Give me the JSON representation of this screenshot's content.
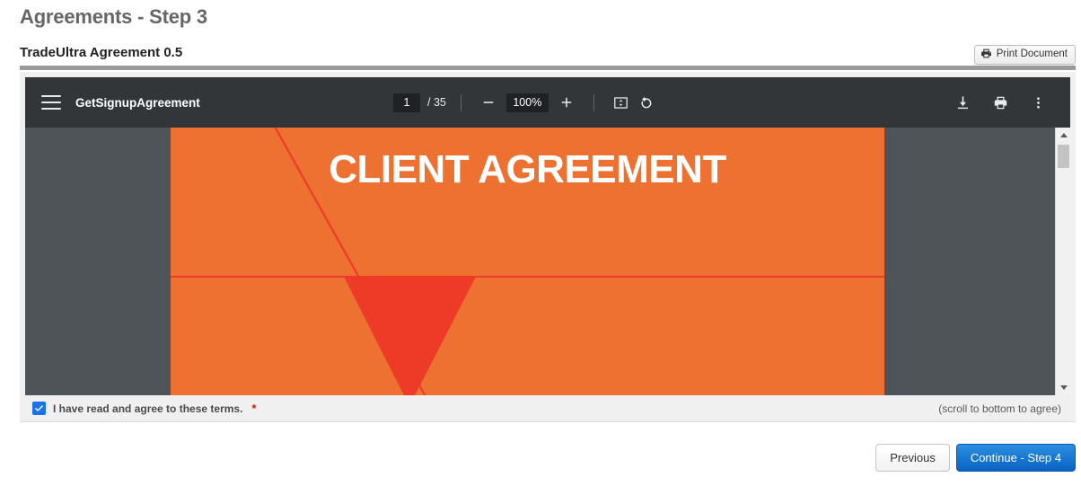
{
  "header": {
    "title": "Agreements - Step 3",
    "subtitle": "TradeUltra Agreement 0.5",
    "print_button_label": "Print Document"
  },
  "pdf_viewer": {
    "document_name": "GetSignupAgreement",
    "current_page": "1",
    "page_total": "/ 35",
    "zoom_level": "100%",
    "icons": {
      "menu": "hamburger-menu-icon",
      "zoom_out": "minus-icon",
      "zoom_in": "plus-icon",
      "fit_page": "fit-to-page-icon",
      "rotate": "rotate-counterclockwise-icon",
      "download": "download-icon",
      "print": "print-icon",
      "more": "more-options-icon"
    },
    "page_content": {
      "heading": "CLIENT AGREEMENT",
      "background_color": "#ED7130",
      "accent_color": "#EE3B28"
    }
  },
  "agreement": {
    "checkbox_checked": true,
    "label": "I have read and agree to these terms.",
    "required_marker": "*",
    "scroll_hint": "(scroll to bottom to agree)"
  },
  "footer": {
    "previous_label": "Previous",
    "continue_label": "Continue - Step 4"
  }
}
